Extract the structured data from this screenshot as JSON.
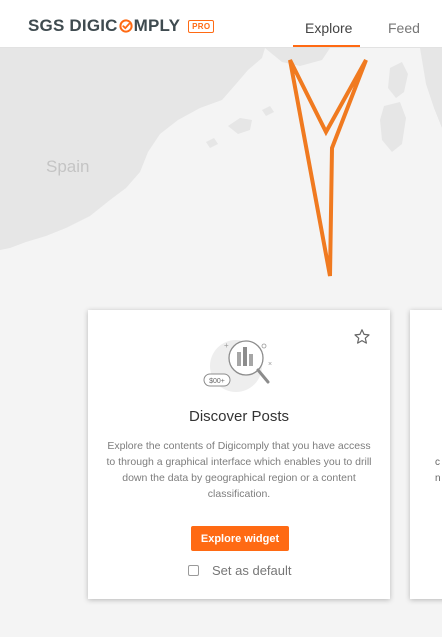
{
  "header": {
    "logo_part1": "SGS DIGIC",
    "logo_part2": "MPLY",
    "pro_badge": "PRO",
    "tabs": [
      {
        "label": "Explore",
        "active": true
      },
      {
        "label": "Feed",
        "active": false
      }
    ]
  },
  "map": {
    "region_label": "Spain"
  },
  "card": {
    "title": "Discover Posts",
    "description": "Explore the contents of Digicomply that  you have access to through a graphical interface which enables you to drill down  the data by geographical region or a content classification.",
    "button_label": "Explore widget",
    "default_label": "Set as default",
    "default_checked": false,
    "illustration_badge": "$00+"
  },
  "next_card_fragments": [
    "c",
    "n"
  ],
  "colors": {
    "accent": "#ff6a13",
    "map_land": "#e6e6e6",
    "background": "#f4f4f4"
  }
}
